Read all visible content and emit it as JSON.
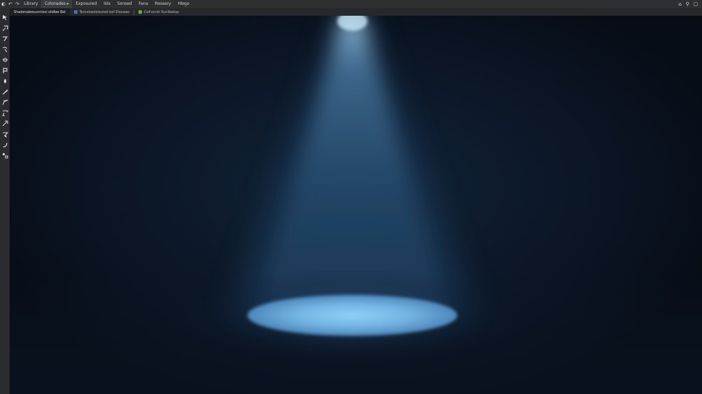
{
  "menubar": {
    "app_icon": "app-logo-icon",
    "items": [
      {
        "label": "Library"
      },
      {
        "label": "Colonades ▸"
      },
      {
        "label": "Exposured"
      },
      {
        "label": "Isla"
      },
      {
        "label": "Sonsed"
      },
      {
        "label": "Fana"
      },
      {
        "label": "Roseary"
      },
      {
        "label": "Hlego"
      }
    ],
    "right_icons": [
      "home-icon",
      "search-icon",
      "window-icon"
    ]
  },
  "tabs": [
    {
      "label": "Shadenabesunniesl slidbw Bal",
      "icon": "document-icon"
    },
    {
      "label": "Tencetaolelaoied bef Dioueas",
      "icon": "layers-icon"
    },
    {
      "label": "Colf.ocrst Sunliketay",
      "icon": "leaf-icon"
    }
  ],
  "tools": [
    "move-tool-icon",
    "marquee-tool-icon",
    "lasso-tool-icon",
    "magic-wand-icon",
    "crop-tool-icon",
    "eyedropper-icon",
    "brush-tool-icon",
    "clone-stamp-icon",
    "pen-tool-icon",
    "type-tool-icon",
    "path-select-icon",
    "shape-tool-icon",
    "hand-tool-icon",
    "zoom-tool-icon"
  ],
  "colors": {
    "menubar_bg": "#2d2f31",
    "panel_bg": "#2a2c2e",
    "canvas_bg": "#0b1320",
    "spotlight": "#7cbde8"
  }
}
